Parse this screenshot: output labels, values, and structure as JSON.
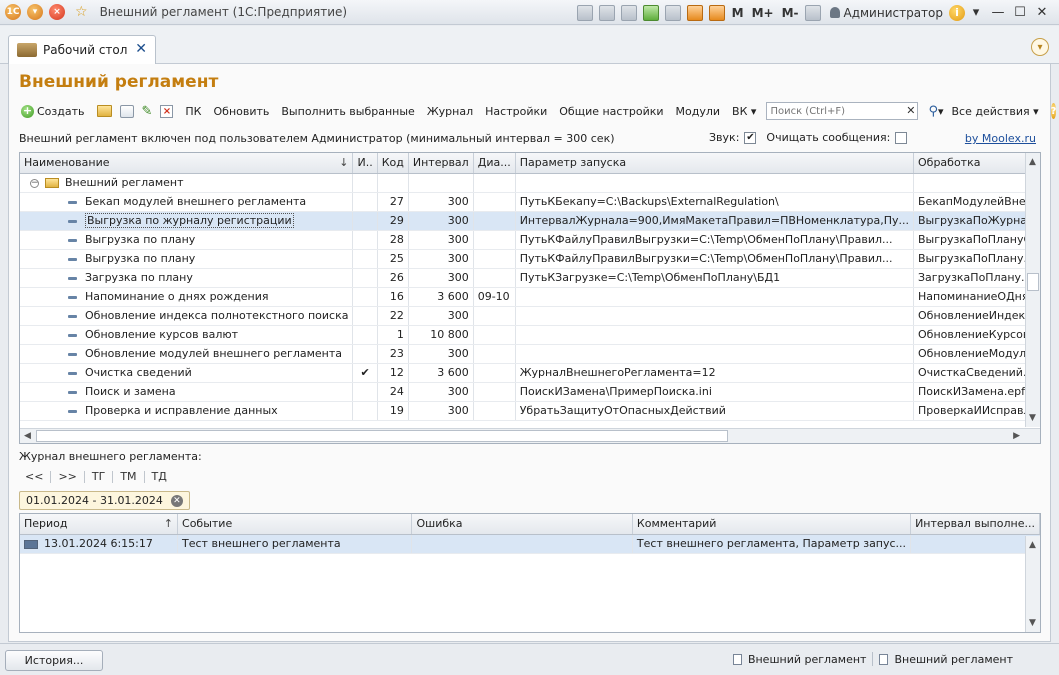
{
  "window": {
    "title": "Внешний регламент  (1С:Предприятие)",
    "user": "Администратор",
    "mem_buttons": [
      "M",
      "M+",
      "M-"
    ]
  },
  "tab": {
    "label": "Рабочий стол"
  },
  "page": {
    "title": "Внешний регламент"
  },
  "toolbar": {
    "create": "Создать",
    "pk": "ПК",
    "refresh": "Обновить",
    "run_selected": "Выполнить выбранные",
    "journal": "Журнал",
    "settings": "Настройки",
    "common_settings": "Общие настройки",
    "modules": "Модули",
    "vk": "ВК",
    "search_placeholder": "Поиск (Ctrl+F)",
    "all_actions": "Все действия"
  },
  "status": {
    "text": "Внешний регламент включен под пользователем Администратор (минимальный интервал = 300 сек)",
    "sound_label": "Звук:",
    "sound_checked": true,
    "clear_messages_label": "Очищать сообщения:",
    "clear_messages_checked": false,
    "link": "by Moolex.ru"
  },
  "tasks": {
    "columns": [
      "Наименование",
      "И..",
      "Код",
      "Интервал",
      "Диа...",
      "Параметр запуска",
      "Обработка"
    ],
    "group": "Внешний регламент",
    "rows": [
      {
        "name": "Бекап модулей внешнего регламента",
        "flag": "",
        "code": "27",
        "interval": "300",
        "range": "",
        "param": "ПутьКБекапу=C:\\Backups\\ExternalRegulation\\",
        "handler": "БекапМодулейВнешнегоРег..."
      },
      {
        "name": "Выгрузка по журналу регистрации",
        "flag": "",
        "code": "29",
        "interval": "300",
        "range": "",
        "param": "ИнтервалЖурнала=900,ИмяМакетаПравил=ПВНоменклатура,Пу...",
        "handler": "ВыгрузкаПоЖурналуРегист...",
        "selected": true
      },
      {
        "name": "Выгрузка по плану",
        "flag": "",
        "code": "28",
        "interval": "300",
        "range": "",
        "param": "ПутьКФайлуПравилВыгрузки=C:\\Temp\\ОбменПоПлану\\Правил...",
        "handler": "ВыгрузкаПоПлануСПодтвер..."
      },
      {
        "name": "Выгрузка по плану",
        "flag": "",
        "code": "25",
        "interval": "300",
        "range": "",
        "param": "ПутьКФайлуПравилВыгрузки=C:\\Temp\\ОбменПоПлану\\Правил...",
        "handler": "ВыгрузкаПоПлану.epf"
      },
      {
        "name": "Загрузка по плану",
        "flag": "",
        "code": "26",
        "interval": "300",
        "range": "",
        "param": "ПутьКЗагрузке=C:\\Temp\\ОбменПоПлану\\БД1",
        "handler": "ЗагрузкаПоПлану.epf"
      },
      {
        "name": "Напоминание о днях рождения",
        "flag": "",
        "code": "16",
        "interval": "3 600",
        "range": "09-10",
        "param": "",
        "handler": "НапоминаниеОДняхРожден..."
      },
      {
        "name": "Обновление индекса полнотекстного поиска",
        "flag": "",
        "code": "22",
        "interval": "300",
        "range": "",
        "param": "",
        "handler": "ОбновлениеИндексаПолнот..."
      },
      {
        "name": "Обновление курсов валют",
        "flag": "",
        "code": "1",
        "interval": "10 800",
        "range": "",
        "param": "",
        "handler": "ОбновлениеКурсовВалют.epf"
      },
      {
        "name": "Обновление модулей внешнего регламента",
        "flag": "",
        "code": "23",
        "interval": "300",
        "range": "",
        "param": "",
        "handler": "ОбновлениеМодулейВнешне..."
      },
      {
        "name": "Очистка сведений",
        "flag": "✔",
        "code": "12",
        "interval": "3 600",
        "range": "",
        "param": "ЖурналВнешнегоРегламента=12",
        "handler": "ОчисткаСведений.epf"
      },
      {
        "name": "Поиск и замена",
        "flag": "",
        "code": "24",
        "interval": "300",
        "range": "",
        "param": "ПоискИЗамена\\ПримерПоиска.ini",
        "handler": "ПоискИЗамена.epf"
      },
      {
        "name": "Проверка и исправление данных",
        "flag": "",
        "code": "19",
        "interval": "300",
        "range": "",
        "param": "УбратьЗащитуОтОпасныхДействий",
        "handler": "ПроверкаИИсправлениеДан..."
      }
    ]
  },
  "journal": {
    "label": "Журнал внешнего регламента:",
    "nav": [
      "<<",
      ">>",
      "ТГ",
      "ТМ",
      "ТД"
    ],
    "period": "01.01.2024 - 31.01.2024",
    "columns": [
      "Период",
      "Событие",
      "Ошибка",
      "Комментарий",
      "Интервал выполне..."
    ],
    "rows": [
      {
        "period": "13.01.2024 6:15:17",
        "event": "Тест внешнего регламента",
        "error": "",
        "comment": "Тест внешнего регламента, Параметр запус...",
        "interval": ""
      }
    ]
  },
  "footer": {
    "history": "История...",
    "windows": [
      "Внешний регламент",
      "Внешний регламент"
    ]
  }
}
